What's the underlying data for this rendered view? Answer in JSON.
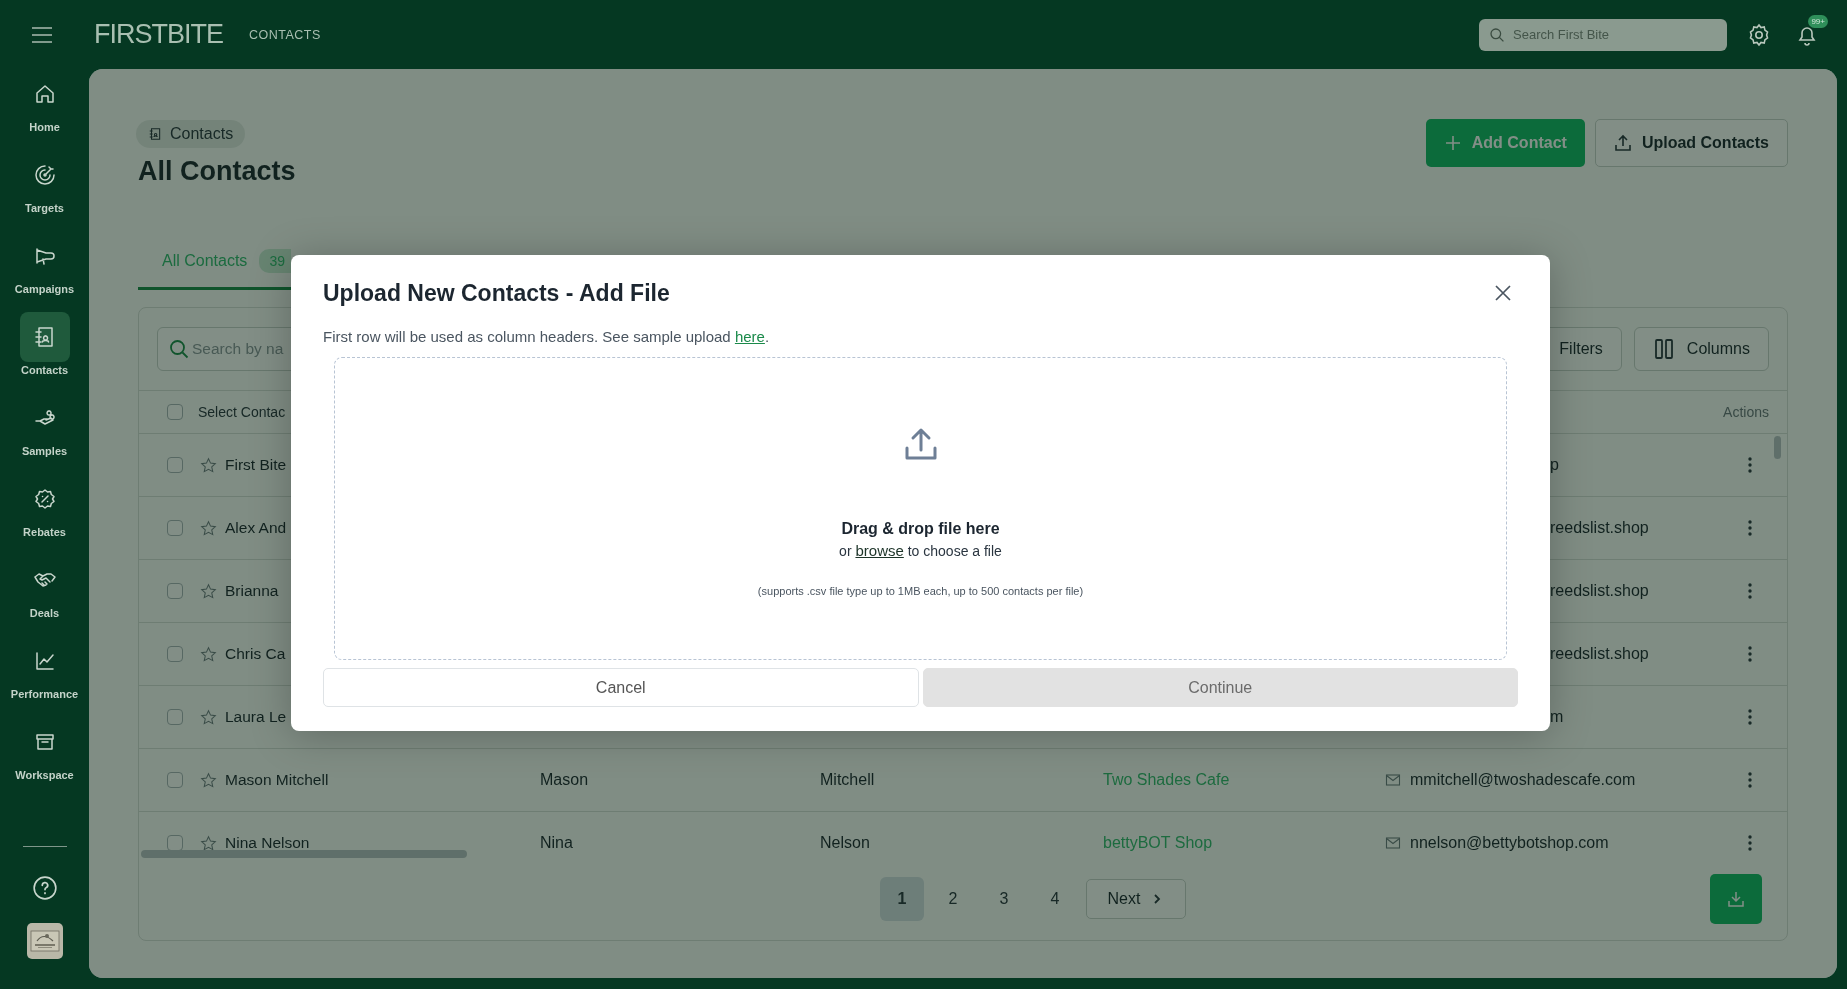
{
  "topbar": {
    "logo": "FIRSTBITE",
    "section": "CONTACTS",
    "search": {
      "placeholder": "Search First Bite"
    },
    "notification_count": "99+"
  },
  "sidebar": {
    "items": [
      {
        "label": "Home",
        "selected": false
      },
      {
        "label": "Targets",
        "selected": false
      },
      {
        "label": "Campaigns",
        "selected": false
      },
      {
        "label": "Contacts",
        "selected": true
      },
      {
        "label": "Samples",
        "selected": false
      },
      {
        "label": "Rebates",
        "selected": false
      },
      {
        "label": "Deals",
        "selected": false
      },
      {
        "label": "Performance",
        "selected": false
      },
      {
        "label": "Workspace",
        "selected": false
      }
    ]
  },
  "header": {
    "breadcrumb": "Contacts",
    "title": "All Contacts",
    "buttons": [
      {
        "label": "Add Contact",
        "kind": "primary"
      },
      {
        "label": "Upload Contacts",
        "kind": "upload"
      }
    ]
  },
  "tabs": [
    {
      "label": "All Contacts",
      "count": "39",
      "selected": true
    }
  ],
  "table": {
    "search": {
      "placeholder": "Search by na"
    },
    "tools": [
      "Filters",
      "Columns"
    ],
    "columns": {
      "select": {
        "label": "Select Contac",
        "checked": false
      },
      "actions": "Actions"
    },
    "rows": [
      {
        "kind": "covered",
        "checked": false,
        "starred": false,
        "name": "First Bite",
        "email": "p"
      },
      {
        "kind": "covered",
        "checked": false,
        "starred": false,
        "name": "Alex And",
        "email": "reedslist.shop"
      },
      {
        "kind": "covered",
        "checked": false,
        "starred": false,
        "name": "Brianna",
        "email": "reedslist.shop"
      },
      {
        "kind": "covered",
        "checked": false,
        "starred": false,
        "name": "Chris Ca",
        "email": "reedslist.shop"
      },
      {
        "kind": "covered",
        "checked": false,
        "starred": false,
        "name": "Laura Le",
        "email": "m"
      },
      {
        "kind": "full",
        "checked": false,
        "starred": false,
        "name": "Mason Mitchell",
        "first_name": "Mason",
        "last_name": "Mitchell",
        "company": "Two Shades Cafe",
        "email": "mmitchell@twoshadescafe.com"
      },
      {
        "kind": "full",
        "checked": false,
        "starred": false,
        "name": "Nina Nelson",
        "first_name": "Nina",
        "last_name": "Nelson",
        "company": "bettyBOT Shop",
        "email": "nnelson@bettybotshop.com"
      }
    ]
  },
  "pagination": {
    "pages": [
      {
        "label": "1",
        "selected": true
      },
      {
        "label": "2",
        "selected": false
      },
      {
        "label": "3",
        "selected": false
      },
      {
        "label": "4",
        "selected": false
      }
    ],
    "next": "Next"
  },
  "modal": {
    "title": "Upload New Contacts - Add File",
    "note": {
      "before": "First row will be used as column headers. See sample upload ",
      "link": "here",
      "after": "."
    },
    "dropzone": {
      "heading": "Drag & drop file here",
      "before": "or ",
      "link": "browse",
      "after": " to choose a file",
      "hint": "(supports .csv file type up to 1MB each, up to 500 contacts per file)"
    },
    "buttons": [
      {
        "label": "Cancel",
        "disabled": false
      },
      {
        "label": "Continue",
        "disabled": true
      }
    ]
  }
}
